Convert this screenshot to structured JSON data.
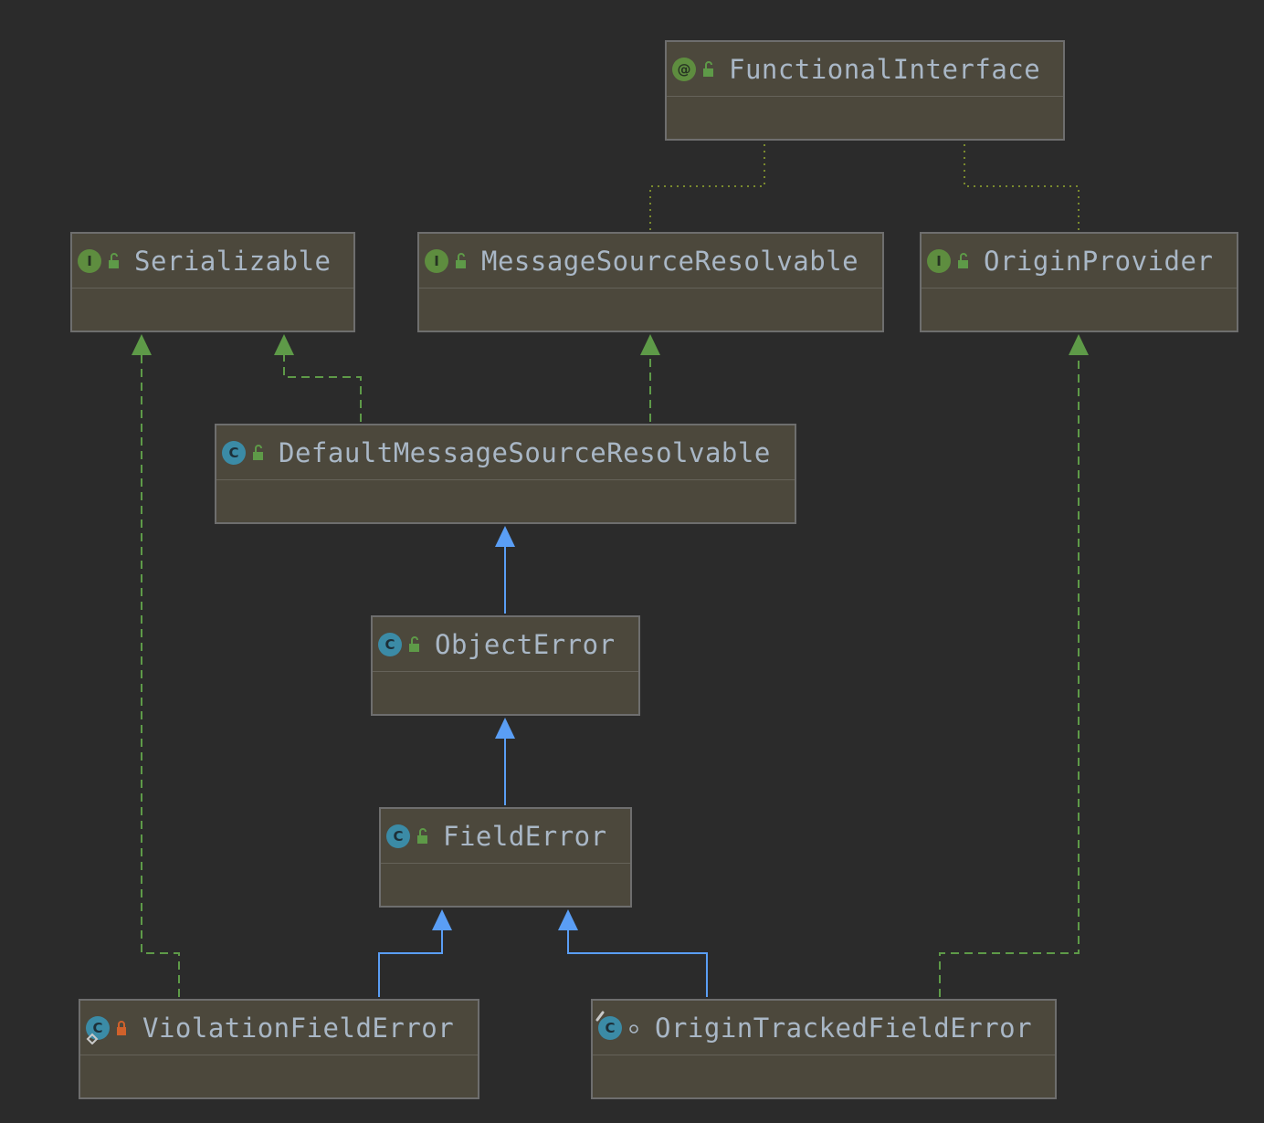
{
  "diagram": {
    "nodes": [
      {
        "id": "functional-interface",
        "name": "FunctionalInterface",
        "kind": "annotation",
        "visibility": "public"
      },
      {
        "id": "serializable",
        "name": "Serializable",
        "kind": "interface",
        "visibility": "public"
      },
      {
        "id": "message-source-resolvable",
        "name": "MessageSourceResolvable",
        "kind": "interface",
        "visibility": "public"
      },
      {
        "id": "origin-provider",
        "name": "OriginProvider",
        "kind": "interface",
        "visibility": "public"
      },
      {
        "id": "default-message-source-resolvable",
        "name": "DefaultMessageSourceResolvable",
        "kind": "class",
        "visibility": "public"
      },
      {
        "id": "object-error",
        "name": "ObjectError",
        "kind": "class",
        "visibility": "public"
      },
      {
        "id": "field-error",
        "name": "FieldError",
        "kind": "class",
        "visibility": "public"
      },
      {
        "id": "violation-field-error",
        "name": "ViolationFieldError",
        "kind": "class",
        "visibility": "private"
      },
      {
        "id": "origin-tracked-field-error",
        "name": "OriginTrackedFieldError",
        "kind": "class",
        "visibility": "package"
      }
    ],
    "kind_letters": {
      "annotation": "@",
      "interface": "I",
      "class": "C"
    },
    "edges": [
      {
        "from": "message-source-resolvable",
        "to": "functional-interface",
        "type": "annotation"
      },
      {
        "from": "origin-provider",
        "to": "functional-interface",
        "type": "annotation"
      },
      {
        "from": "default-message-source-resolvable",
        "to": "serializable",
        "type": "implements"
      },
      {
        "from": "default-message-source-resolvable",
        "to": "message-source-resolvable",
        "type": "implements"
      },
      {
        "from": "object-error",
        "to": "default-message-source-resolvable",
        "type": "extends"
      },
      {
        "from": "field-error",
        "to": "object-error",
        "type": "extends"
      },
      {
        "from": "violation-field-error",
        "to": "field-error",
        "type": "extends"
      },
      {
        "from": "origin-tracked-field-error",
        "to": "field-error",
        "type": "extends"
      },
      {
        "from": "violation-field-error",
        "to": "serializable",
        "type": "implements"
      },
      {
        "from": "origin-tracked-field-error",
        "to": "origin-provider",
        "type": "implements"
      }
    ],
    "colors": {
      "background": "#2b2b2b",
      "extends": "#5a9ef5",
      "implements": "#5e9a48",
      "annotation": "#7a8a2e",
      "visibility_public": "#5e9a48",
      "visibility_private": "#d0612b"
    }
  }
}
